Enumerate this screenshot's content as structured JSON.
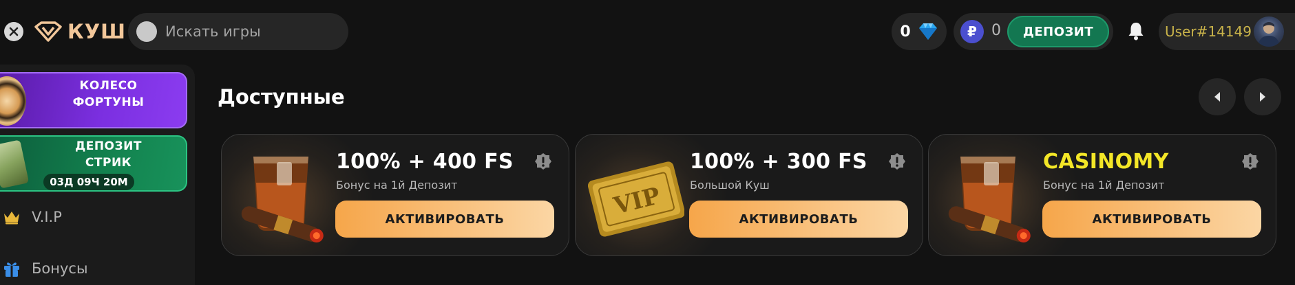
{
  "header": {
    "logo_text": "КУШ",
    "search_placeholder": "Искать игры",
    "gems_count": "0",
    "balance": "0",
    "deposit_label": "ДЕПОЗИТ",
    "username": "User#14149"
  },
  "sidebar": {
    "wheel_label_line1": "КОЛЕСО",
    "wheel_label_line2": "ФОРТУНЫ",
    "streak_label_line1": "ДЕПОЗИТ",
    "streak_label_line2": "СТРИК",
    "streak_timer": "03Д 09Ч 20М",
    "items": [
      {
        "label": "V.I.P",
        "icon": "crown-icon"
      },
      {
        "label": "Бонусы",
        "icon": "gift-icon"
      }
    ]
  },
  "main": {
    "section_title": "Доступные",
    "cards": [
      {
        "title": "100% + 400 FS",
        "subtitle": "Бонус на 1й Депозит",
        "button": "АКТИВИРОВАТЬ",
        "art": "whiskey-cigar"
      },
      {
        "title": "100% + 300 FS",
        "subtitle": "Большой Куш",
        "button": "АКТИВИРОВАТЬ",
        "art": "vip-ticket"
      },
      {
        "title": "CASINOMY",
        "subtitle": "Бонус на 1й Депозит",
        "button": "АКТИВИРОВАТЬ",
        "art": "whiskey-cigar"
      }
    ]
  },
  "colors": {
    "background": "#121212",
    "surface": "#262626",
    "deposit_green": "#137751",
    "accent_orange": "#f6a64a",
    "casinomy_yellow": "#f3e627",
    "username_gold": "#c9b34a"
  },
  "icon_names": [
    "close-icon",
    "logo-icon",
    "search-icon",
    "diamond-icon",
    "ruble-icon",
    "bell-icon",
    "avatar",
    "chevron-left-icon",
    "chevron-right-icon",
    "info-icon"
  ]
}
